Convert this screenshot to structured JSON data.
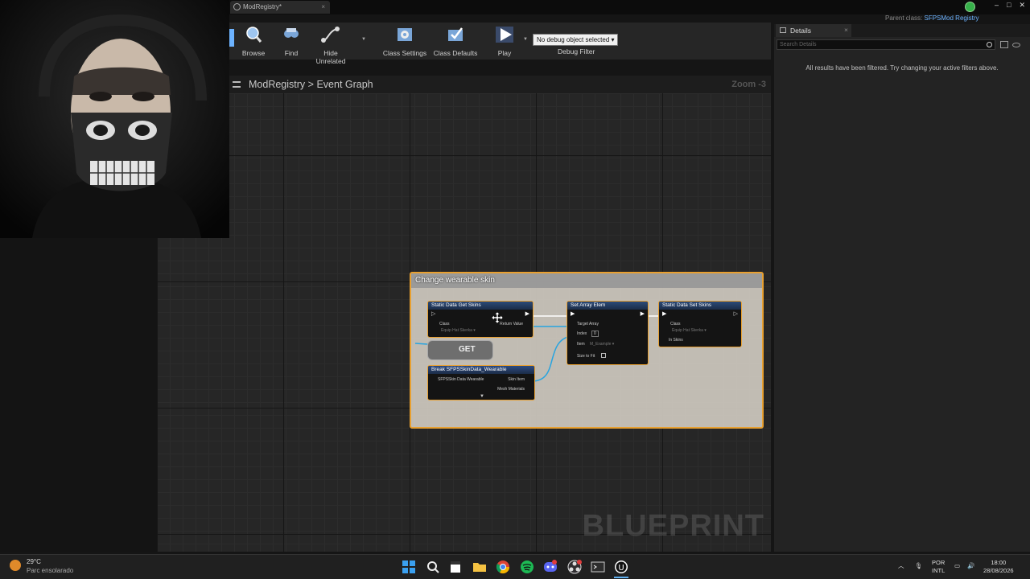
{
  "window": {
    "tab_title": "ModRegistry*",
    "parent_class_label": "Parent class:",
    "parent_class_value": "SFPSMod Registry",
    "controls": [
      "–",
      "□",
      "✕"
    ]
  },
  "toolbar": {
    "buttons": [
      {
        "label": "Browse",
        "icon": "browse-icon"
      },
      {
        "label": "Find",
        "icon": "find-icon"
      },
      {
        "label": "Hide Unrelated",
        "icon": "hide-unrelated-icon"
      },
      {
        "label": "Class Settings",
        "icon": "class-settings-icon"
      },
      {
        "label": "Class Defaults",
        "icon": "class-defaults-icon"
      },
      {
        "label": "Play",
        "icon": "play-icon"
      }
    ],
    "debug_object": "No debug object selected ▾",
    "debug_filter_label": "Debug Filter"
  },
  "graph": {
    "breadcrumb_root": "ModRegistry",
    "breadcrumb_separator": ">",
    "breadcrumb_current": "Event Graph",
    "zoom": "Zoom -3",
    "watermark": "BLUEPRINT",
    "comment_title": "Change wearable skin",
    "nodes": {
      "get_skins": {
        "title": "Static Data Get Skins",
        "pin_class": "Class",
        "pin_class_value": "Equip Hat Skerka ▾",
        "pin_return": "Return Value"
      },
      "get": {
        "title": "GET"
      },
      "break_skin": {
        "title": "Break SFPSSkinData_Wearable",
        "pin_in": "SFPSSkin Data Wearable",
        "pin_skin_item": "Skin Item",
        "pin_mesh": "Mesh Materials"
      },
      "set_array": {
        "title": "Set Array Elem",
        "pin_target": "Target Array",
        "pin_index": "Index",
        "pin_index_value": "0",
        "pin_item": "Item",
        "pin_item_value": "M_Example ▾",
        "pin_size": "Size to Fit"
      },
      "set_skins": {
        "title": "Static Data Set Skins",
        "pin_class": "Class",
        "pin_class_value": "Equip Hat Skerka ▾",
        "pin_skins": "In Skins"
      }
    }
  },
  "details": {
    "tab_label": "Details",
    "search_placeholder": "Search Details",
    "filtered_message": "All results have been filtered. Try changing your active filters above."
  },
  "taskbar": {
    "weather_temp": "29°C",
    "weather_desc": "Parc ensolarado",
    "apps": [
      "windows-start-icon",
      "search-icon",
      "terminal-icon",
      "file-explorer-icon",
      "chrome-icon",
      "spotify-icon",
      "discord-icon",
      "obs-icon",
      "terminal-icon",
      "unreal-engine-icon"
    ],
    "language_line1": "POR",
    "language_line2": "INTL",
    "time": "18:00",
    "date": "28/08/2026"
  },
  "colors": {
    "comment_border": "#e8a030",
    "node_header": "#2c4a78",
    "link_blue": "#6db3ff",
    "wire_blue": "#27a4e0"
  }
}
